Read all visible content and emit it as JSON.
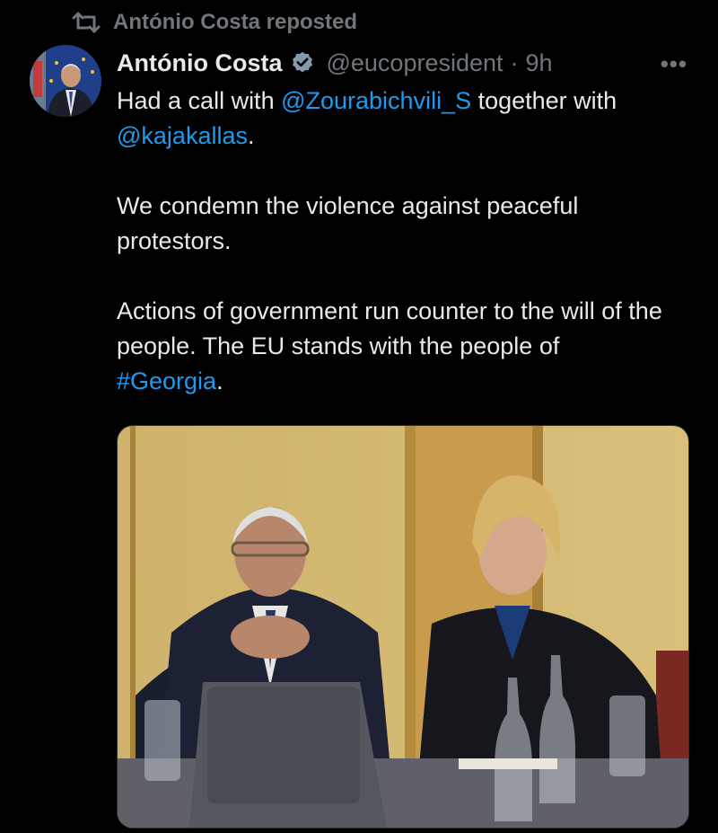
{
  "repost": {
    "icon": "repost-icon",
    "text": "António Costa reposted"
  },
  "author": {
    "name": "António Costa",
    "handle": "@eucopresident",
    "separator": "·",
    "time": "9h",
    "verified_icon": "verified-badge-icon"
  },
  "more_label": "•••",
  "tweet": {
    "line1_pre": "Had a call with ",
    "mention1": "@Zourabichvili_S",
    "line1_post": " together with",
    "mention2": "@kajakallas",
    "line2_post": ".",
    "para2": "We condemn the violence against peaceful protestors.",
    "para3_text": "Actions of government run counter to the will of the people. The EU stands with the people of",
    "hashtag": "#Georgia",
    "para3_end": "."
  },
  "colors": {
    "background": "#000000",
    "text": "#e7e9ea",
    "muted": "#71767b",
    "link": "#1d9bf0",
    "verified": "#829aab"
  }
}
